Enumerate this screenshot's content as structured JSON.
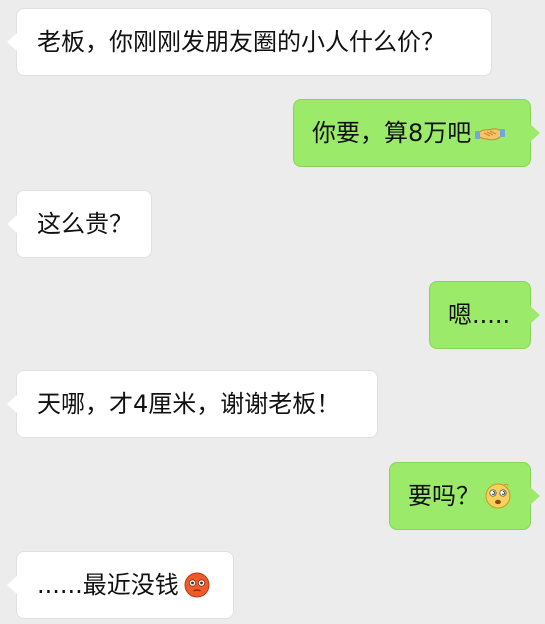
{
  "messages": [
    {
      "side": "left",
      "text": "老板，你刚刚发朋友圈的小人什么价？",
      "emoji": ""
    },
    {
      "side": "right",
      "text": "你要，算8万吧",
      "emoji": "handshake-icon"
    },
    {
      "side": "left",
      "text": "这么贵？",
      "emoji": ""
    },
    {
      "side": "right",
      "text": "嗯.....",
      "emoji": ""
    },
    {
      "side": "left",
      "text": "天哪，才4厘米，谢谢老板！",
      "emoji": ""
    },
    {
      "side": "right",
      "text": "要吗？",
      "emoji": "dizzy-face-icon"
    },
    {
      "side": "left",
      "text": "......最近没钱",
      "emoji": "flushed-face-icon"
    }
  ],
  "colors": {
    "background": "#ececec",
    "incoming_bubble": "#ffffff",
    "outgoing_bubble": "#9bea6a"
  }
}
